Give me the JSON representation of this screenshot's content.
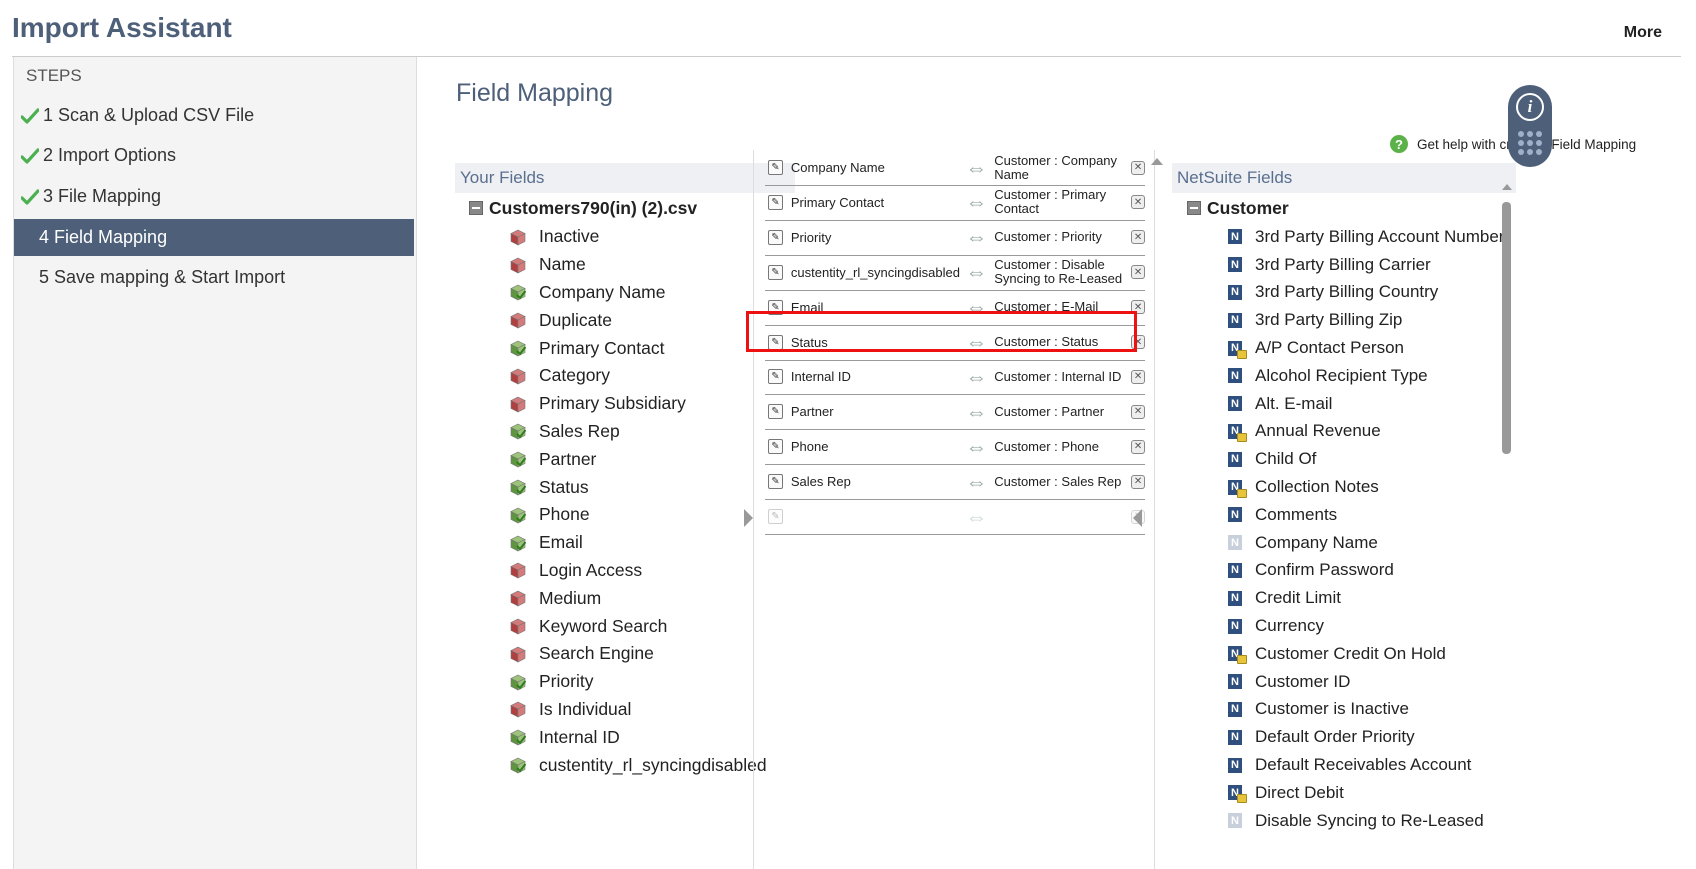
{
  "header": {
    "title": "Import Assistant",
    "more_label": "More"
  },
  "sidebar": {
    "heading": "STEPS",
    "steps": [
      {
        "label": "1 Scan & Upload CSV File",
        "done": true
      },
      {
        "label": "2 Import Options",
        "done": true
      },
      {
        "label": "3 File Mapping",
        "done": true
      },
      {
        "label": "4 Field Mapping",
        "active": true
      },
      {
        "label": "5 Save mapping & Start Import"
      }
    ]
  },
  "main": {
    "title": "Field Mapping",
    "help_label": "Get help with creating Field Mapping"
  },
  "your_fields": {
    "header": "Your Fields",
    "file_name": "Customers790(in) (2).csv",
    "items": [
      {
        "label": "Inactive",
        "mapped": false
      },
      {
        "label": "Name",
        "mapped": false
      },
      {
        "label": "Company Name",
        "mapped": true
      },
      {
        "label": "Duplicate",
        "mapped": false
      },
      {
        "label": "Primary Contact",
        "mapped": true
      },
      {
        "label": "Category",
        "mapped": false
      },
      {
        "label": "Primary Subsidiary",
        "mapped": false
      },
      {
        "label": "Sales Rep",
        "mapped": true
      },
      {
        "label": "Partner",
        "mapped": true
      },
      {
        "label": "Status",
        "mapped": true
      },
      {
        "label": "Phone",
        "mapped": true
      },
      {
        "label": "Email",
        "mapped": true
      },
      {
        "label": "Login Access",
        "mapped": false
      },
      {
        "label": "Medium",
        "mapped": false
      },
      {
        "label": "Keyword Search",
        "mapped": false
      },
      {
        "label": "Search Engine",
        "mapped": false
      },
      {
        "label": "Priority",
        "mapped": true
      },
      {
        "label": "Is Individual",
        "mapped": false
      },
      {
        "label": "Internal ID",
        "mapped": true
      },
      {
        "label": "custentity_rl_syncingdisabled",
        "mapped": true
      }
    ]
  },
  "mappings": [
    {
      "source": "Company Name",
      "target": "Customer : Company Name"
    },
    {
      "source": "Primary Contact",
      "target": "Customer : Primary Contact"
    },
    {
      "source": "Priority",
      "target": "Customer : Priority"
    },
    {
      "source": "custentity_rl_syncingdisabled",
      "target": "Customer : Disable Syncing to Re-Leased"
    },
    {
      "source": "Email",
      "target": "Customer : E-Mail"
    },
    {
      "source": "Status",
      "target": "Customer : Status"
    },
    {
      "source": "Internal ID",
      "target": "Customer : Internal ID"
    },
    {
      "source": "Partner",
      "target": "Customer : Partner"
    },
    {
      "source": "Phone",
      "target": "Customer : Phone"
    },
    {
      "source": "Sales Rep",
      "target": "Customer : Sales Rep"
    },
    {
      "source": "",
      "target": ""
    }
  ],
  "netsuite_fields": {
    "header": "NetSuite Fields",
    "root": "Customer",
    "items": [
      {
        "label": "3rd Party Billing Account Number"
      },
      {
        "label": "3rd Party Billing Carrier"
      },
      {
        "label": "3rd Party Billing Country"
      },
      {
        "label": "3rd Party Billing Zip"
      },
      {
        "label": "A/P Contact Person",
        "locked": true
      },
      {
        "label": "Alcohol Recipient Type"
      },
      {
        "label": "Alt. E-mail"
      },
      {
        "label": "Annual Revenue",
        "locked": true
      },
      {
        "label": "Child Of"
      },
      {
        "label": "Collection Notes",
        "locked": true
      },
      {
        "label": "Comments"
      },
      {
        "label": "Company Name",
        "disabled": true
      },
      {
        "label": "Confirm Password"
      },
      {
        "label": "Credit Limit"
      },
      {
        "label": "Currency"
      },
      {
        "label": "Customer Credit On Hold",
        "locked": true
      },
      {
        "label": "Customer ID"
      },
      {
        "label": "Customer is Inactive"
      },
      {
        "label": "Default Order Priority"
      },
      {
        "label": "Default Receivables Account"
      },
      {
        "label": "Direct Debit",
        "locked": true
      },
      {
        "label": "Disable Syncing to Re-Leased",
        "disabled": true
      }
    ]
  },
  "icons": {
    "step_done": "check-icon",
    "field_unmapped": "red-cube-icon",
    "field_mapped": "green-check-cube-icon",
    "netsuite_field": "netsuite-field-icon",
    "edit": "pencil-icon",
    "delete": "close-icon",
    "arrow": "double-arrow-icon"
  },
  "colors": {
    "brand": "#4d5f79",
    "highlight": "#ee1111",
    "check": "#4caf50"
  }
}
